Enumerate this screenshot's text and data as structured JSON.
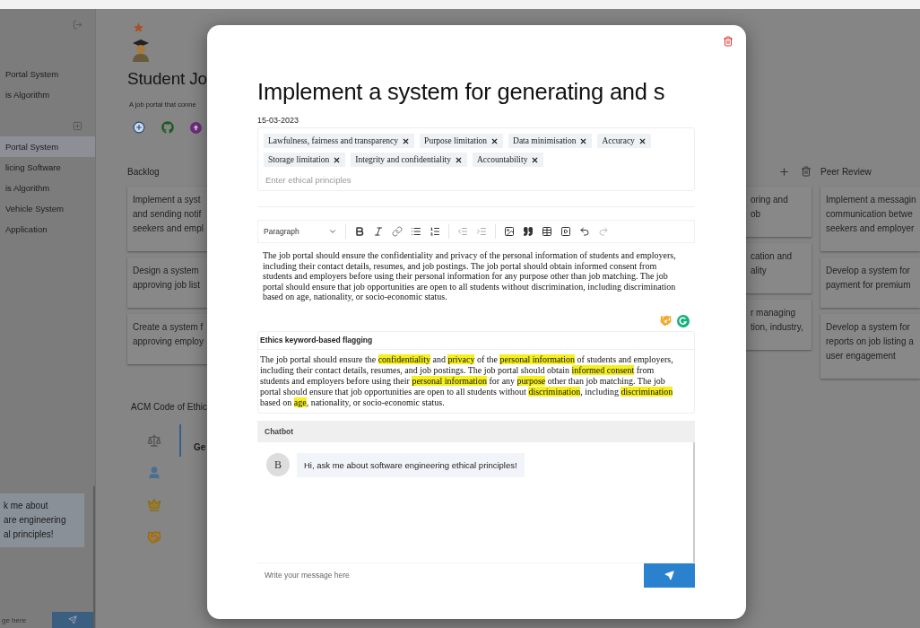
{
  "sidebar": {
    "pinned": [
      {
        "label": "Portal System"
      },
      {
        "label": "is Algorithm"
      }
    ],
    "projects": [
      {
        "label": "Portal System",
        "selected": true
      },
      {
        "label": "licing Software",
        "selected": false
      },
      {
        "label": "is Algorithm",
        "selected": false
      },
      {
        "label": "Vehicle System",
        "selected": false
      },
      {
        "label": "Application",
        "selected": false
      }
    ],
    "chat": {
      "message_lines": [
        "k me about",
        "are engineering",
        "al principles!"
      ],
      "placeholder": "ge here"
    }
  },
  "project": {
    "title": "Student Jo",
    "description": "A job portal that conne"
  },
  "board": {
    "columns": [
      {
        "title": "Backlog",
        "show_actions": false,
        "cards": [
          {
            "lines": [
              "Implement a syst",
              "and sending notif",
              "seekers and empl"
            ]
          },
          {
            "lines": [
              "Design a system",
              "approving job list"
            ]
          },
          {
            "lines": [
              "Create a system f",
              "approving employ"
            ]
          }
        ]
      },
      {
        "show_actions": true,
        "cards": [
          {
            "lines": [
              "oring and",
              "ob"
            ]
          },
          {
            "lines": [
              "cation and",
              "ality"
            ]
          },
          {
            "lines": [
              "r managing",
              "tion, industry,"
            ]
          }
        ]
      },
      {
        "title": "Peer Review",
        "show_actions": false,
        "cards": [
          {
            "lines": [
              "Implement a messagin",
              "communication betwe",
              "seekers and employer"
            ]
          },
          {
            "lines": [
              "Develop a system for",
              "payment for premium"
            ]
          },
          {
            "lines": [
              "Develop a system for",
              "reports on job listing a",
              "user engagement"
            ]
          }
        ]
      }
    ]
  },
  "acm": {
    "title": "ACM Code of Ethic",
    "tabs": [
      {
        "kind": "scales",
        "selected": true
      },
      {
        "kind": "person",
        "selected": false
      },
      {
        "kind": "crown",
        "selected": false
      },
      {
        "kind": "handshake",
        "selected": false
      }
    ],
    "panel_heading": "Ge"
  },
  "modal": {
    "title": "Implement a system for generating and s",
    "date": "15-03-2023",
    "principles": [
      "Lawfulness, fairness and transparency",
      "Purpose limitation",
      "Data minimisation",
      "Accuracy",
      "Storage limitation",
      "Integrity and confidentiality",
      "Accountability"
    ],
    "principles_placeholder": "Enter ethical principles",
    "editor": {
      "block_style": "Paragraph",
      "text": "The job portal should ensure the confidentiality and privacy of the personal information of students and employers, including their contact details, resumes, and job postings. The job portal should obtain informed consent from students and employers before using their personal information for any purpose other than job matching. The job portal should ensure that job opportunities are open to all students without discrimination, including discrimination based on age, nationality, or socio-economic status."
    },
    "flagging": {
      "title": "Ethics keyword-based flagging",
      "segments": [
        {
          "text": "The job portal should ensure the ",
          "flagged": false
        },
        {
          "text": "confidentiality",
          "flagged": true
        },
        {
          "text": " and ",
          "flagged": false
        },
        {
          "text": "privacy",
          "flagged": true
        },
        {
          "text": " of the ",
          "flagged": false
        },
        {
          "text": "personal information",
          "flagged": true
        },
        {
          "text": " of students and employers, including their contact details, resumes, and job postings. The job portal should obtain ",
          "flagged": false
        },
        {
          "text": "informed consent",
          "flagged": true
        },
        {
          "text": " from students and employers before using their ",
          "flagged": false
        },
        {
          "text": "personal information",
          "flagged": true
        },
        {
          "text": " for any ",
          "flagged": false
        },
        {
          "text": "purpose",
          "flagged": true
        },
        {
          "text": " other than job matching. The job portal should ensure that job opportunities are open to all students without ",
          "flagged": false
        },
        {
          "text": "discrimination",
          "flagged": true
        },
        {
          "text": ", including ",
          "flagged": false
        },
        {
          "text": "discrimination",
          "flagged": true
        },
        {
          "text": " based on ",
          "flagged": false
        },
        {
          "text": "age",
          "flagged": true
        },
        {
          "text": ", nationality, or socio-economic status.",
          "flagged": false
        }
      ]
    },
    "chatbot": {
      "title": "Chatbot",
      "messages": [
        {
          "avatar": "B",
          "text": "Hi, ask me about software engineering ethical principles!"
        }
      ],
      "placeholder": "Write your message here"
    }
  }
}
